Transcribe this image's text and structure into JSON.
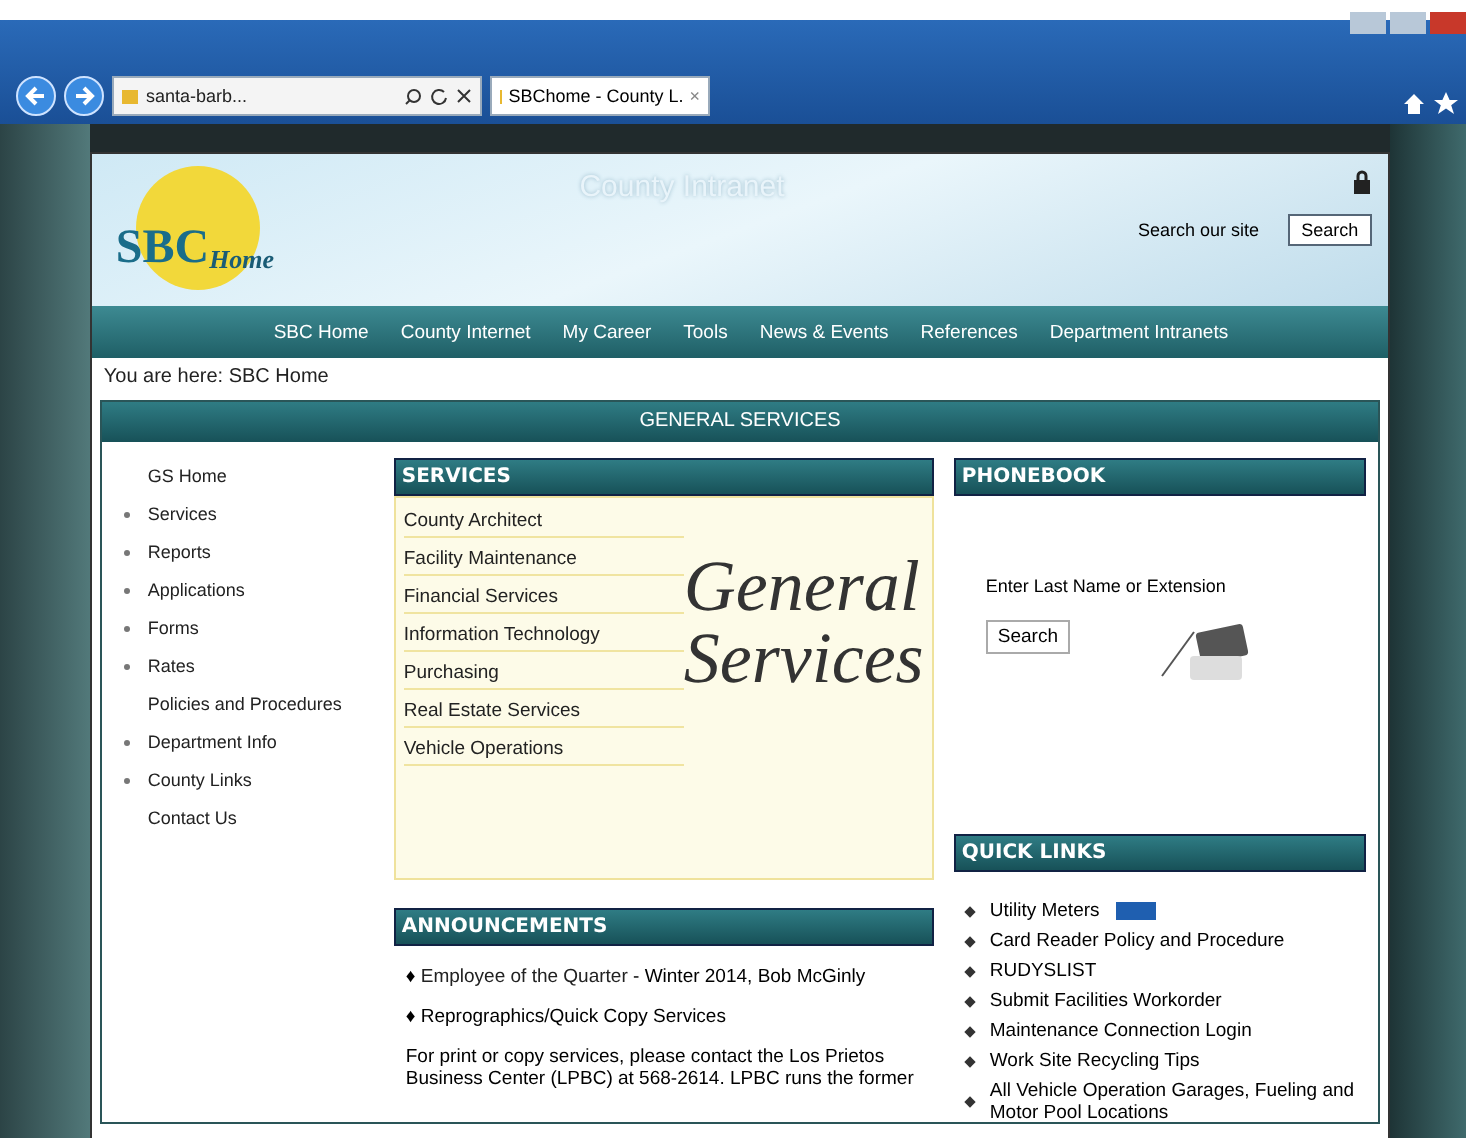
{
  "browser": {
    "address": "santa-barb...",
    "tab_title": "SBChome - County L.",
    "tab_close": "×"
  },
  "header": {
    "title": "County Intranet",
    "logo_main": "SBC",
    "logo_sub": "Home",
    "search_label": "Search our site",
    "search_button": "Search"
  },
  "nav": [
    "SBC Home",
    "County Internet",
    "My Career",
    "Tools",
    "News & Events",
    "References",
    "Department Intranets"
  ],
  "breadcrumb": "You are here: SBC Home",
  "panel_title": "GENERAL SERVICES",
  "sidebar": [
    {
      "label": "GS Home",
      "bullet": false
    },
    {
      "label": "Services",
      "bullet": true
    },
    {
      "label": "Reports",
      "bullet": true
    },
    {
      "label": "Applications",
      "bullet": true
    },
    {
      "label": "Forms",
      "bullet": true
    },
    {
      "label": "Rates",
      "bullet": true
    },
    {
      "label": "Policies and Procedures",
      "bullet": false
    },
    {
      "label": "Department Info",
      "bullet": true
    },
    {
      "label": "County Links",
      "bullet": true
    },
    {
      "label": "Contact Us",
      "bullet": false
    }
  ],
  "services": {
    "title": "SERVICES",
    "items": [
      "County Architect",
      "Facility Maintenance",
      "Financial Services",
      "Information Technology",
      "Purchasing",
      "Real Estate Services",
      "Vehicle Operations"
    ],
    "emblem_line1": "General",
    "emblem_line2": "Services"
  },
  "announcements": {
    "title": "ANNOUNCEMENTS",
    "items": [
      {
        "mark": "♦",
        "link": "Employee of the Quarter",
        "text": " - Winter 2014, Bob McGinly"
      },
      {
        "mark": "♦",
        "text": "Reprographics/Quick Copy Services"
      }
    ],
    "body": "For print or copy services, please contact the Los Prietos Business Center (LPBC) at 568-2614. LPBC runs the former"
  },
  "phonebook": {
    "title": "PHONEBOOK",
    "label": "Enter Last Name or Extension",
    "button": "Search"
  },
  "quick_links": {
    "title": "QUICK LINKS",
    "items": [
      "Utility Meters",
      "Card Reader Policy and Procedure",
      "RUDYSLIST",
      "Submit Facilities Workorder",
      "Maintenance Connection Login",
      "Work Site Recycling Tips",
      "All Vehicle Operation Garages, Fueling and Motor Pool Locations"
    ]
  }
}
